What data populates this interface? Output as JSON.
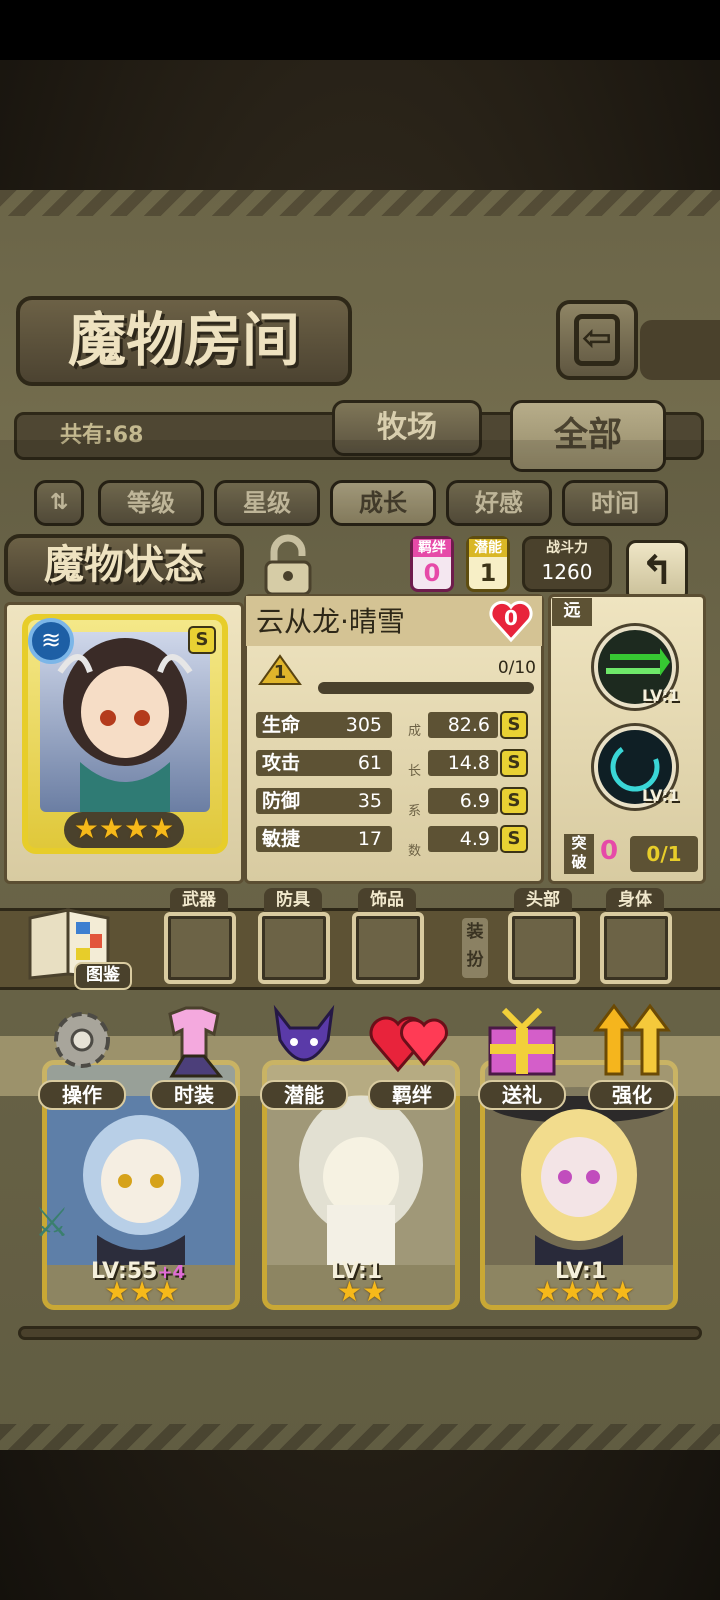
{
  "room": {
    "title": "魔物房间",
    "count_text": "共有:68",
    "tabs": [
      {
        "label": "牧场",
        "active": false
      },
      {
        "label": "全部",
        "active": true
      }
    ],
    "sort_buttons": [
      {
        "label": "等级",
        "active": false
      },
      {
        "label": "星级",
        "active": false
      },
      {
        "label": "成长",
        "active": true
      },
      {
        "label": "好感",
        "active": false
      },
      {
        "label": "时间",
        "active": false
      }
    ]
  },
  "status": {
    "title": "魔物状态",
    "bond_label": "羁绊",
    "bond_value": "0",
    "potential_label": "潜能",
    "potential_value": "1",
    "power_label": "战斗力",
    "power_value": "1260",
    "monster_name": "云从龙·晴雪",
    "affection": "0",
    "rank_level": "1",
    "exp_text": "0/10",
    "rarity": "S",
    "stars": 4,
    "stats": [
      {
        "name": "生命",
        "value": "305",
        "grow": "82.6",
        "grade": "S"
      },
      {
        "name": "攻击",
        "value": "61",
        "grow": "14.8",
        "grade": "S"
      },
      {
        "name": "防御",
        "value": "35",
        "grow": "6.9",
        "grade": "S"
      },
      {
        "name": "敏捷",
        "value": "17",
        "grow": "4.9",
        "grade": "S"
      }
    ],
    "growth_chars": [
      "成",
      "长",
      "系",
      "数"
    ],
    "range_label": "远",
    "skills": [
      {
        "lv": "LV:1"
      },
      {
        "lv": "LV:1"
      }
    ],
    "breakthrough_label_1": "突",
    "breakthrough_label_2": "破",
    "breakthrough_value": "0",
    "breakthrough_progress": "0/1"
  },
  "equipment": {
    "codex_label": "图鉴",
    "dress_label_1": "装",
    "dress_label_2": "扮",
    "slots": [
      {
        "label": "武器"
      },
      {
        "label": "防具"
      },
      {
        "label": "饰品"
      },
      {
        "label": "头部"
      },
      {
        "label": "身体"
      }
    ]
  },
  "actions": [
    {
      "label": "操作",
      "icon": "gear-icon"
    },
    {
      "label": "时装",
      "icon": "outfit-icon"
    },
    {
      "label": "潜能",
      "icon": "potential-demon-icon"
    },
    {
      "label": "羁绊",
      "icon": "bond-hearts-icon"
    },
    {
      "label": "送礼",
      "icon": "gift-icon"
    },
    {
      "label": "强化",
      "icon": "upgrade-arrows-icon"
    }
  ],
  "cards": [
    {
      "lv": "LV:55",
      "bonus": "+4",
      "stars": 3
    },
    {
      "lv": "LV:1",
      "bonus": "",
      "stars": 2
    },
    {
      "lv": "LV:1",
      "bonus": "",
      "stars": 4
    }
  ],
  "colors": {
    "gold": "#c9a835",
    "parchment": "#efe4c0",
    "dark_brown": "#4a412c",
    "heart_red": "#e8233b",
    "pink_badge": "#e64aa8",
    "skill_green": "#36c832",
    "skill_cyan": "#3ad6d6"
  }
}
